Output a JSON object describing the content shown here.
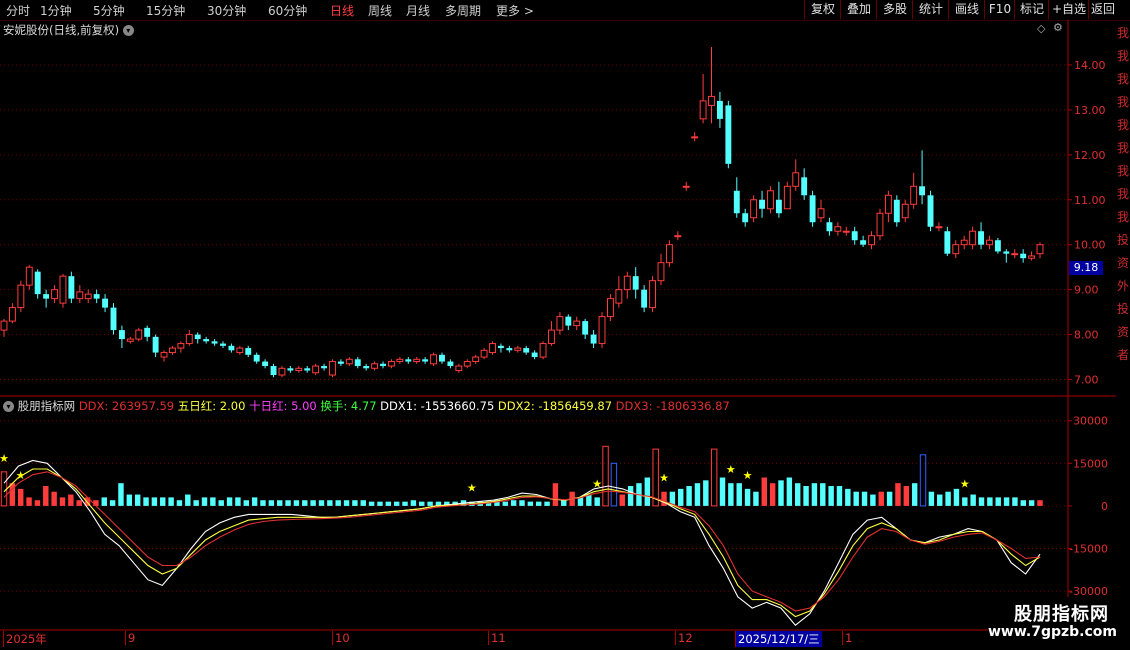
{
  "topbar": {
    "tabs": [
      "分时",
      "1分钟",
      "5分钟",
      "15分钟",
      "30分钟",
      "60分钟",
      "日线",
      "周线",
      "月线",
      "多周期",
      "更多"
    ],
    "active_tab": "日线",
    "more_arrow": ">",
    "right_buttons": [
      "复权",
      "叠加",
      "多股",
      "统计",
      "画线",
      "F10",
      "标记",
      "+自选",
      "返回"
    ]
  },
  "main_panel": {
    "title": "安妮股份(日线,前复权)",
    "dropdown_icon": "chevron-down-icon",
    "price_tag": "9.18"
  },
  "indicator_panel": {
    "name": "股朋指标网",
    "items": [
      {
        "label": "DDX: 263957.59",
        "color": "#e03030"
      },
      {
        "label": "五日红: 2.00",
        "color": "#ffff40"
      },
      {
        "label": "十日红: 5.00",
        "color": "#ff40ff"
      },
      {
        "label": "换手: 4.77",
        "color": "#40ff40"
      },
      {
        "label": "DDX1: -1553660.75",
        "color": "#ffffff"
      },
      {
        "label": "DDX2: -1856459.87",
        "color": "#ffff40"
      },
      {
        "label": "DDX3: -1806336.87",
        "color": "#e03030"
      }
    ]
  },
  "x_axis": {
    "labels": [
      "2025年",
      "9",
      "10",
      "11",
      "12",
      "2025/12/17/三",
      "1"
    ]
  },
  "watermark": {
    "title": "股朋指标网",
    "url": "www.7gpzb.com"
  },
  "right_strip": {
    "text": "我我我我我我我我我投资外投资者"
  },
  "colors": {
    "up": "#ff3c3c",
    "down": "#54ffff",
    "ddx1": "#ffffff",
    "ddx2": "#ffff40",
    "ddx3": "#e03030",
    "grid": "#6e0000",
    "star": "#ffff00"
  },
  "chart_data": [
    {
      "type": "candlestick",
      "title": "安妮股份(日线,前复权)",
      "y_ticks": [
        7.0,
        8.0,
        9.0,
        10.0,
        11.0,
        12.0,
        13.0,
        14.0
      ],
      "ylim": [
        6.7,
        14.6
      ],
      "last_price": 9.18,
      "candles": [
        [
          8.1,
          8.3,
          7.95,
          8.35
        ],
        [
          8.3,
          8.6,
          8.25,
          8.7
        ],
        [
          8.6,
          9.1,
          8.5,
          9.2
        ],
        [
          9.1,
          9.5,
          9.0,
          9.55
        ],
        [
          9.4,
          8.9,
          8.8,
          9.45
        ],
        [
          8.9,
          8.8,
          8.6,
          9.0
        ],
        [
          8.8,
          9.0,
          8.7,
          9.1
        ],
        [
          8.7,
          9.3,
          8.6,
          9.35
        ],
        [
          9.3,
          8.8,
          8.7,
          9.4
        ],
        [
          8.8,
          8.95,
          8.7,
          9.1
        ],
        [
          8.8,
          8.9,
          8.7,
          9.0
        ],
        [
          8.9,
          8.8,
          8.7,
          9.0
        ],
        [
          8.8,
          8.6,
          8.5,
          8.9
        ],
        [
          8.6,
          8.1,
          8.0,
          8.7
        ],
        [
          8.1,
          7.9,
          7.7,
          8.2
        ],
        [
          7.85,
          7.9,
          7.8,
          7.95
        ],
        [
          7.9,
          8.1,
          7.85,
          8.15
        ],
        [
          8.15,
          7.95,
          7.85,
          8.2
        ],
        [
          7.95,
          7.6,
          7.5,
          8.0
        ],
        [
          7.5,
          7.6,
          7.4,
          7.65
        ],
        [
          7.6,
          7.7,
          7.55,
          7.75
        ],
        [
          7.7,
          7.8,
          7.6,
          7.85
        ],
        [
          7.8,
          8.0,
          7.75,
          8.1
        ],
        [
          8.0,
          7.9,
          7.8,
          8.05
        ],
        [
          7.9,
          7.85,
          7.8,
          7.95
        ],
        [
          7.85,
          7.8,
          7.75,
          7.9
        ],
        [
          7.8,
          7.75,
          7.7,
          7.85
        ],
        [
          7.75,
          7.65,
          7.6,
          7.8
        ],
        [
          7.6,
          7.7,
          7.55,
          7.75
        ],
        [
          7.7,
          7.55,
          7.5,
          7.75
        ],
        [
          7.55,
          7.4,
          7.35,
          7.6
        ],
        [
          7.4,
          7.3,
          7.25,
          7.45
        ],
        [
          7.3,
          7.1,
          7.05,
          7.35
        ],
        [
          7.1,
          7.25,
          7.05,
          7.3
        ],
        [
          7.25,
          7.2,
          7.15,
          7.3
        ],
        [
          7.2,
          7.25,
          7.15,
          7.3
        ],
        [
          7.25,
          7.2,
          7.15,
          7.3
        ],
        [
          7.15,
          7.3,
          7.1,
          7.35
        ],
        [
          7.3,
          7.25,
          7.2,
          7.35
        ],
        [
          7.1,
          7.4,
          7.05,
          7.45
        ],
        [
          7.4,
          7.35,
          7.3,
          7.45
        ],
        [
          7.35,
          7.45,
          7.3,
          7.5
        ],
        [
          7.45,
          7.3,
          7.25,
          7.5
        ],
        [
          7.3,
          7.25,
          7.2,
          7.35
        ],
        [
          7.25,
          7.35,
          7.2,
          7.4
        ],
        [
          7.35,
          7.3,
          7.25,
          7.4
        ],
        [
          7.3,
          7.4,
          7.25,
          7.45
        ],
        [
          7.4,
          7.45,
          7.35,
          7.5
        ],
        [
          7.45,
          7.4,
          7.35,
          7.5
        ],
        [
          7.4,
          7.45,
          7.35,
          7.5
        ],
        [
          7.45,
          7.4,
          7.35,
          7.5
        ],
        [
          7.35,
          7.55,
          7.3,
          7.6
        ],
        [
          7.55,
          7.4,
          7.35,
          7.6
        ],
        [
          7.4,
          7.3,
          7.25,
          7.45
        ],
        [
          7.2,
          7.3,
          7.15,
          7.35
        ],
        [
          7.3,
          7.4,
          7.25,
          7.45
        ],
        [
          7.4,
          7.5,
          7.35,
          7.55
        ],
        [
          7.5,
          7.65,
          7.45,
          7.7
        ],
        [
          7.6,
          7.8,
          7.55,
          7.85
        ],
        [
          7.75,
          7.7,
          7.6,
          7.8
        ],
        [
          7.7,
          7.65,
          7.6,
          7.75
        ],
        [
          7.65,
          7.7,
          7.6,
          7.75
        ],
        [
          7.7,
          7.6,
          7.55,
          7.75
        ],
        [
          7.6,
          7.5,
          7.45,
          7.65
        ],
        [
          7.5,
          7.8,
          7.45,
          7.85
        ],
        [
          7.8,
          8.1,
          7.75,
          8.3
        ],
        [
          8.1,
          8.4,
          8.0,
          8.5
        ],
        [
          8.4,
          8.2,
          8.1,
          8.45
        ],
        [
          8.2,
          8.3,
          8.1,
          8.4
        ],
        [
          8.3,
          8.0,
          7.9,
          8.35
        ],
        [
          8.0,
          7.8,
          7.7,
          8.1
        ],
        [
          7.8,
          8.4,
          7.7,
          8.5
        ],
        [
          8.4,
          8.8,
          8.3,
          8.9
        ],
        [
          8.7,
          9.0,
          8.6,
          9.3
        ],
        [
          9.0,
          9.3,
          8.8,
          9.4
        ],
        [
          9.3,
          9.0,
          8.8,
          9.5
        ],
        [
          9.0,
          8.6,
          8.5,
          9.1
        ],
        [
          8.6,
          9.2,
          8.5,
          9.3
        ],
        [
          9.2,
          9.6,
          9.1,
          9.8
        ],
        [
          9.6,
          10.0,
          9.5,
          10.1
        ],
        [
          10.2,
          10.2,
          10.1,
          10.3
        ],
        [
          11.3,
          11.3,
          11.2,
          11.4
        ],
        [
          12.4,
          12.4,
          12.3,
          12.5
        ],
        [
          12.8,
          13.2,
          12.7,
          13.8
        ],
        [
          13.1,
          13.3,
          12.7,
          14.4
        ],
        [
          13.2,
          12.8,
          12.6,
          13.4
        ],
        [
          13.1,
          11.8,
          11.7,
          13.2
        ],
        [
          11.2,
          10.7,
          10.6,
          11.5
        ],
        [
          10.7,
          10.5,
          10.4,
          10.8
        ],
        [
          10.6,
          11.0,
          10.5,
          11.1
        ],
        [
          11.0,
          10.8,
          10.6,
          11.2
        ],
        [
          10.8,
          11.2,
          10.7,
          11.3
        ],
        [
          11.0,
          10.7,
          10.6,
          11.4
        ],
        [
          10.8,
          11.3,
          10.8,
          11.4
        ],
        [
          11.3,
          11.6,
          11.2,
          11.9
        ],
        [
          11.5,
          11.1,
          11.0,
          11.7
        ],
        [
          11.1,
          10.5,
          10.4,
          11.2
        ],
        [
          10.6,
          10.8,
          10.5,
          11.0
        ],
        [
          10.5,
          10.3,
          10.2,
          10.6
        ],
        [
          10.3,
          10.4,
          10.2,
          10.5
        ],
        [
          10.3,
          10.3,
          10.2,
          10.4
        ],
        [
          10.3,
          10.1,
          10.0,
          10.4
        ],
        [
          10.1,
          10.0,
          9.95,
          10.2
        ],
        [
          10.0,
          10.2,
          9.9,
          10.3
        ],
        [
          10.2,
          10.7,
          10.1,
          10.8
        ],
        [
          10.7,
          11.1,
          10.5,
          11.2
        ],
        [
          11.0,
          10.5,
          10.4,
          11.1
        ],
        [
          10.6,
          10.9,
          10.5,
          11.0
        ],
        [
          10.9,
          11.3,
          10.8,
          11.6
        ],
        [
          11.3,
          11.1,
          10.9,
          12.1
        ],
        [
          11.1,
          10.4,
          10.3,
          11.2
        ],
        [
          10.4,
          10.4,
          10.3,
          10.5
        ],
        [
          10.3,
          9.8,
          9.75,
          10.4
        ],
        [
          9.8,
          10.0,
          9.7,
          10.1
        ],
        [
          10.0,
          10.1,
          9.9,
          10.2
        ],
        [
          10.0,
          10.3,
          9.9,
          10.4
        ],
        [
          10.3,
          10.0,
          9.9,
          10.5
        ],
        [
          10.0,
          10.1,
          9.9,
          10.2
        ],
        [
          10.1,
          9.85,
          9.8,
          10.15
        ],
        [
          9.85,
          9.8,
          9.6,
          9.9
        ],
        [
          9.8,
          9.8,
          9.7,
          9.9
        ],
        [
          9.8,
          9.7,
          9.6,
          9.9
        ],
        [
          9.7,
          9.75,
          9.65,
          9.85
        ],
        [
          9.8,
          10.0,
          9.7,
          10.05
        ]
      ]
    },
    {
      "type": "bar",
      "title": "股朋指标网",
      "y_ticks": [
        30000,
        15000,
        0,
        -15000,
        -30000
      ],
      "ylim": [
        -43000,
        38000
      ],
      "bars": [
        12000,
        8000,
        6000,
        3000,
        2000,
        7000,
        5000,
        3000,
        4000,
        2000,
        3000,
        2000,
        -3000,
        -2000,
        -8000,
        -4000,
        -4000,
        -3000,
        -3000,
        -3000,
        -3000,
        -2000,
        -4000,
        -2000,
        -3000,
        -3000,
        -2000,
        -3000,
        -3000,
        -2000,
        -3000,
        -2000,
        -2000,
        -2000,
        -2000,
        -2000,
        -2000,
        -2000,
        -2000,
        -2000,
        -2000,
        -2000,
        -2000,
        -2000,
        -1500,
        -1500,
        -1500,
        -1500,
        -1500,
        -2000,
        -1500,
        -1500,
        -1500,
        -1500,
        -1500,
        -2000,
        -1500,
        -1500,
        -1500,
        -2000,
        -1500,
        -2000,
        -2000,
        -1500,
        -1500,
        -1500,
        8000,
        -2000,
        5000,
        -3000,
        -4000,
        -3000,
        21000,
        -15000,
        4000,
        -7000,
        -8000,
        -10000,
        20000,
        5000,
        -5000,
        -6000,
        -7000,
        -8000,
        -9000,
        20000,
        -10000,
        -8000,
        -8000,
        -6000,
        -5000,
        10000,
        8000,
        -9000,
        -10000,
        -8000,
        -7000,
        -8000,
        -8000,
        -7000,
        -7000,
        -6000,
        -5000,
        -5000,
        -4000,
        5000,
        -5000,
        8000,
        7000,
        -8000,
        -18000,
        -5000,
        -4000,
        -5000,
        -6000,
        -3000,
        -4000,
        -3000,
        -3000,
        -3000,
        -3000,
        -3000,
        -2000,
        -2000,
        2000
      ],
      "series": [
        {
          "name": "DDX1",
          "values": [
            8000,
            14000,
            16000,
            15000,
            10000,
            5000,
            -2000,
            -10000,
            -14000,
            -20000,
            -26000,
            -28000,
            -22000,
            -15000,
            -9000,
            -6000,
            -4000,
            -3000,
            -3000,
            -3000,
            -3000,
            -3500,
            -4000,
            -4000,
            -3500,
            -3000,
            -2500,
            -2000,
            -1500,
            -1000,
            0,
            500,
            1000,
            1500,
            2000,
            3000,
            4500,
            4000,
            2500,
            2000,
            3000,
            6000,
            7000,
            6000,
            4000,
            3000,
            1000,
            -2000,
            -4000,
            -14000,
            -22000,
            -32000,
            -36000,
            -34000,
            -36000,
            -42000,
            -38000,
            -30000,
            -20000,
            -10000,
            -5000,
            -4000,
            -8000,
            -12000,
            -13000,
            -11000,
            -10000,
            -8000,
            -9000,
            -12000,
            -20000,
            -24000,
            -17000
          ]
        },
        {
          "name": "DDX2",
          "values": [
            5000,
            10000,
            13000,
            13000,
            10000,
            6000,
            0,
            -6000,
            -11000,
            -16000,
            -21000,
            -24000,
            -22000,
            -17000,
            -12000,
            -9000,
            -7000,
            -5000,
            -4500,
            -4000,
            -4000,
            -4000,
            -4000,
            -4000,
            -3500,
            -3000,
            -2500,
            -2000,
            -1500,
            -1000,
            0,
            200,
            500,
            1000,
            1500,
            2500,
            3500,
            3500,
            2500,
            2000,
            3000,
            5000,
            6000,
            5000,
            4000,
            3000,
            1200,
            -1000,
            -3000,
            -10000,
            -18000,
            -28000,
            -33000,
            -33000,
            -35000,
            -39000,
            -37000,
            -31000,
            -23000,
            -14000,
            -8000,
            -6000,
            -8000,
            -12000,
            -13000,
            -12000,
            -10000,
            -9000,
            -9000,
            -12000,
            -17000,
            -21000,
            -18000
          ]
        },
        {
          "name": "DDX3",
          "values": [
            3000,
            8000,
            11000,
            12000,
            10000,
            7000,
            2000,
            -3000,
            -8000,
            -13000,
            -18000,
            -21000,
            -21000,
            -18000,
            -14000,
            -11000,
            -8500,
            -6500,
            -5500,
            -5000,
            -4800,
            -4600,
            -4500,
            -4300,
            -4000,
            -3500,
            -3000,
            -2500,
            -2000,
            -1500,
            -500,
            0,
            300,
            700,
            1200,
            2000,
            3000,
            3200,
            2600,
            2200,
            2800,
            4300,
            5200,
            4800,
            4000,
            3200,
            1500,
            -500,
            -2000,
            -7000,
            -14000,
            -24000,
            -30000,
            -32000,
            -34000,
            -37000,
            -36000,
            -32000,
            -26000,
            -18000,
            -11000,
            -8000,
            -9000,
            -12000,
            -13500,
            -12500,
            -11000,
            -10000,
            -9500,
            -12000,
            -15000,
            -18500,
            -18000
          ]
        }
      ],
      "stars_at_bar": [
        0,
        2,
        56,
        71,
        79,
        87,
        89,
        115
      ]
    }
  ]
}
